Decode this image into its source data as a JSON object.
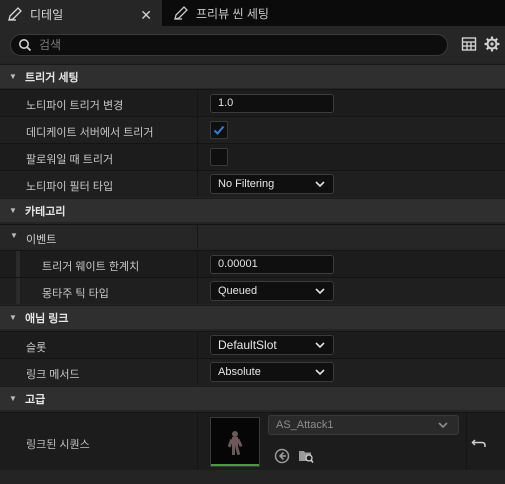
{
  "tabs": [
    {
      "label": "디테일",
      "icon": "pencil-icon",
      "active": true
    },
    {
      "label": "프리뷰 씬 세팅",
      "icon": "pencil-icon",
      "active": false
    }
  ],
  "search": {
    "placeholder": "검색"
  },
  "categories": {
    "trigger": "트리거 세팅",
    "category": "카테고리",
    "event": "이벤트",
    "anim_link": "애님 링크",
    "advanced": "고급"
  },
  "properties": {
    "notify_trigger_change": {
      "label": "노티파이 트리거 변경",
      "value": "1.0"
    },
    "trigger_on_dedicated": {
      "label": "데디케이트 서버에서 트리거",
      "checked": true
    },
    "trigger_on_follower": {
      "label": "팔로워일 때 트리거",
      "checked": false
    },
    "notify_filter_type": {
      "label": "노티파이 필터 타입",
      "value": "No Filtering"
    },
    "trigger_weight_threshold": {
      "label": "트리거 웨이트 한계치",
      "value": "0.00001"
    },
    "montage_tick_type": {
      "label": "몽타주 틱 타입",
      "value": "Queued"
    },
    "slot": {
      "label": "슬롯",
      "value": "DefaultSlot"
    },
    "link_method": {
      "label": "링크 메서드",
      "value": "Absolute"
    },
    "linked_sequence": {
      "label": "링크된 시퀀스",
      "value": "AS_Attack1"
    }
  },
  "colors": {
    "accent": "#2f7fd6",
    "thumbnail_bar": "#4a9a3a"
  }
}
